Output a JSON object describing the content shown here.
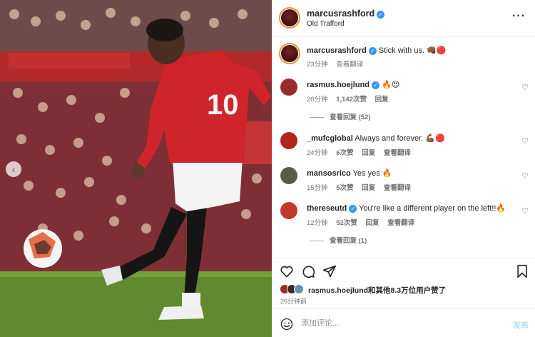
{
  "post": {
    "photo_alt_icon": "chevron-left-icon"
  },
  "header": {
    "username": "marcusrashford",
    "location": "Old Trafford",
    "more_label": "···"
  },
  "caption": {
    "username": "marcusrashford",
    "text": "Stick with us. 👊🏾🔴",
    "time": "23分钟",
    "translate": "查看翻译"
  },
  "comments": [
    {
      "username": "rasmus.hoejlund",
      "verified": true,
      "text": "🔥😍",
      "time": "20分钟",
      "likes": "1,142次赞",
      "reply": "回复",
      "translate": "",
      "view_replies": "查看回复 (52)",
      "avatar_color": "#9b2a2a"
    },
    {
      "username": "_mufcglobal",
      "verified": false,
      "text": "Always and forever. 💪🏾🔴",
      "time": "24分钟",
      "likes": "6次赞",
      "reply": "回复",
      "translate": "查看翻译",
      "view_replies": "",
      "avatar_color": "#b3261e"
    },
    {
      "username": "mansosrico",
      "verified": false,
      "text": "Yes yes 🔥",
      "time": "15分钟",
      "likes": "5次赞",
      "reply": "回复",
      "translate": "查看翻译",
      "view_replies": "",
      "avatar_color": "#5b5a4c"
    },
    {
      "username": "thereseutd",
      "verified": true,
      "text": "You're like a different player on the left!!🔥",
      "time": "12分钟",
      "likes": "52次赞",
      "reply": "回复",
      "translate": "查看翻译",
      "view_replies": "查看回复 (1)",
      "avatar_color": "#c0392b"
    }
  ],
  "likes": {
    "text": "rasmus.hoejlund和其他8.3万位用户赞了",
    "time": "26分钟前"
  },
  "add_comment": {
    "placeholder": "添加评论...",
    "post_label": "发布"
  },
  "colors": {
    "accent": "#3897f0",
    "jersey_red": "#d0242b",
    "pitch_green": "#5f8a2e"
  }
}
